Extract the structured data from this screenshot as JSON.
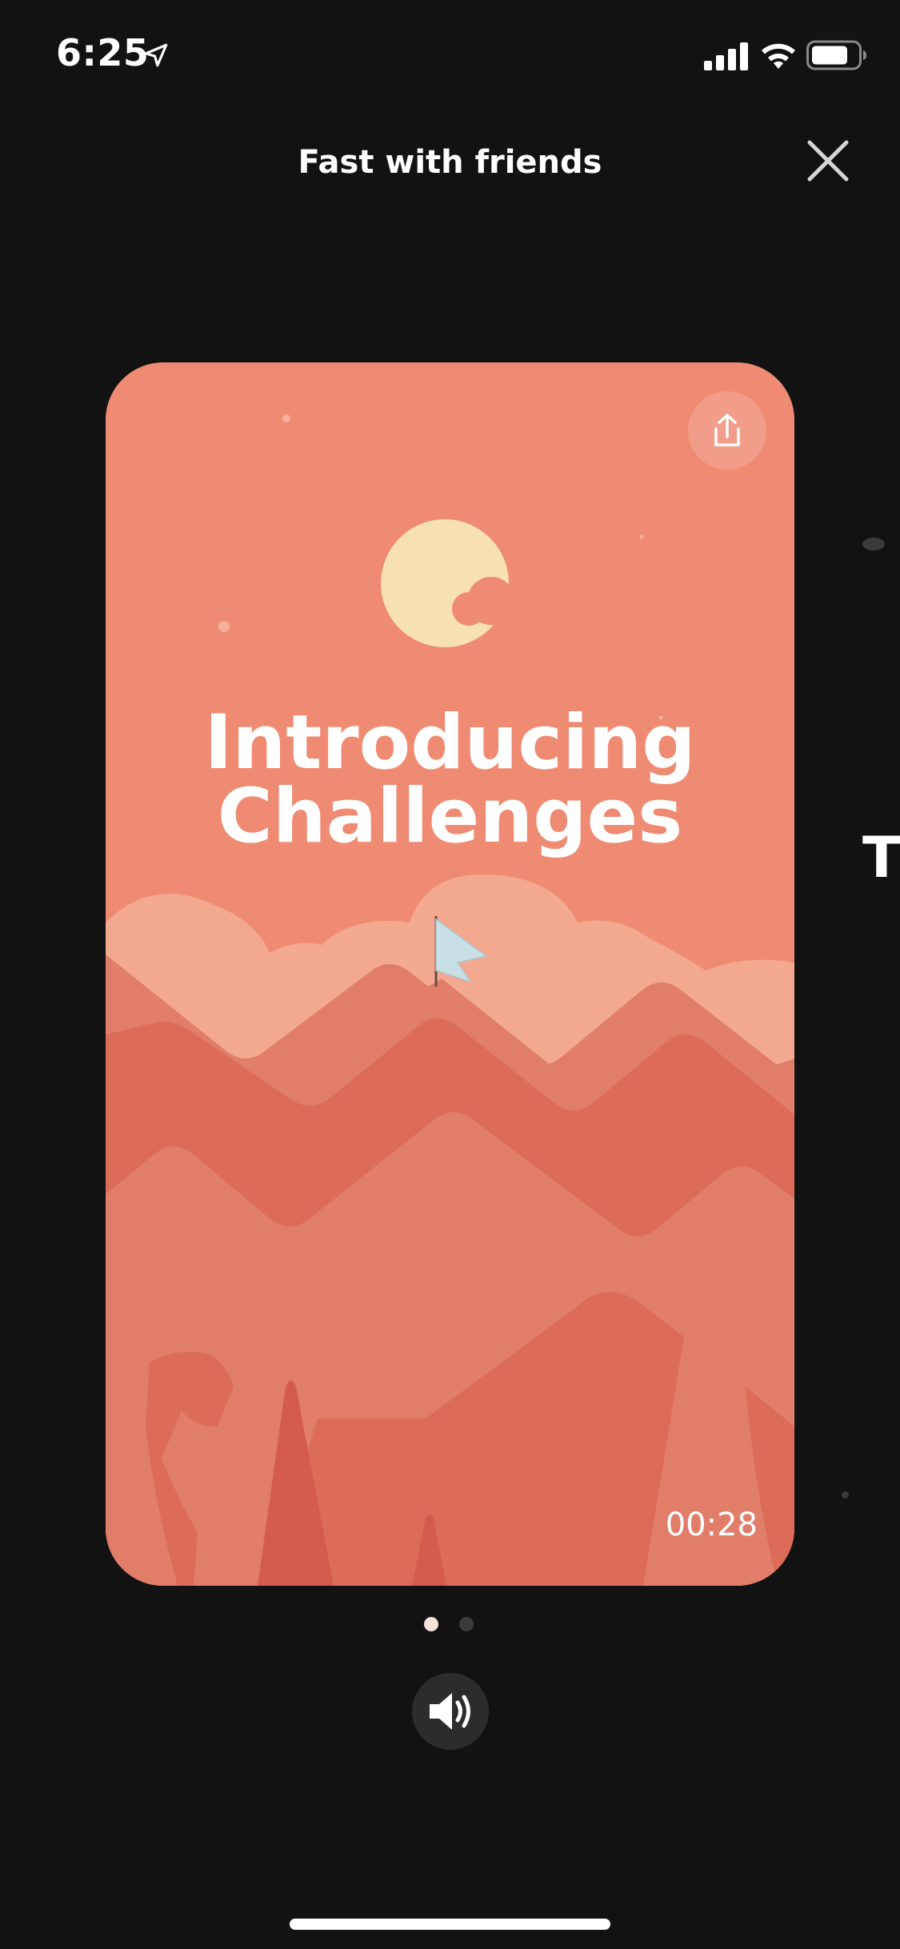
{
  "status_bar": {
    "time": "6:25",
    "icons": [
      "location-arrow-icon",
      "cellular-signal-icon",
      "wifi-icon",
      "battery-icon"
    ]
  },
  "header": {
    "title": "Fast with friends",
    "close_icon": "close-icon"
  },
  "story_card": {
    "title_line1": "Introducing",
    "title_line2": "Challenges",
    "timer": "00:28",
    "share_icon": "share-icon",
    "colors": {
      "background": "#ef8b73",
      "moon": "#f7e0b1",
      "clouds": "#f2a990",
      "mountains_back": "#e07e6a",
      "mountains_mid": "#dc6b58",
      "flag": "#c9dfe6"
    }
  },
  "next_card_peek": {
    "text": "T"
  },
  "pager": {
    "count": 2,
    "active_index": 0
  },
  "sound_button": {
    "icon": "speaker-volume-icon"
  }
}
